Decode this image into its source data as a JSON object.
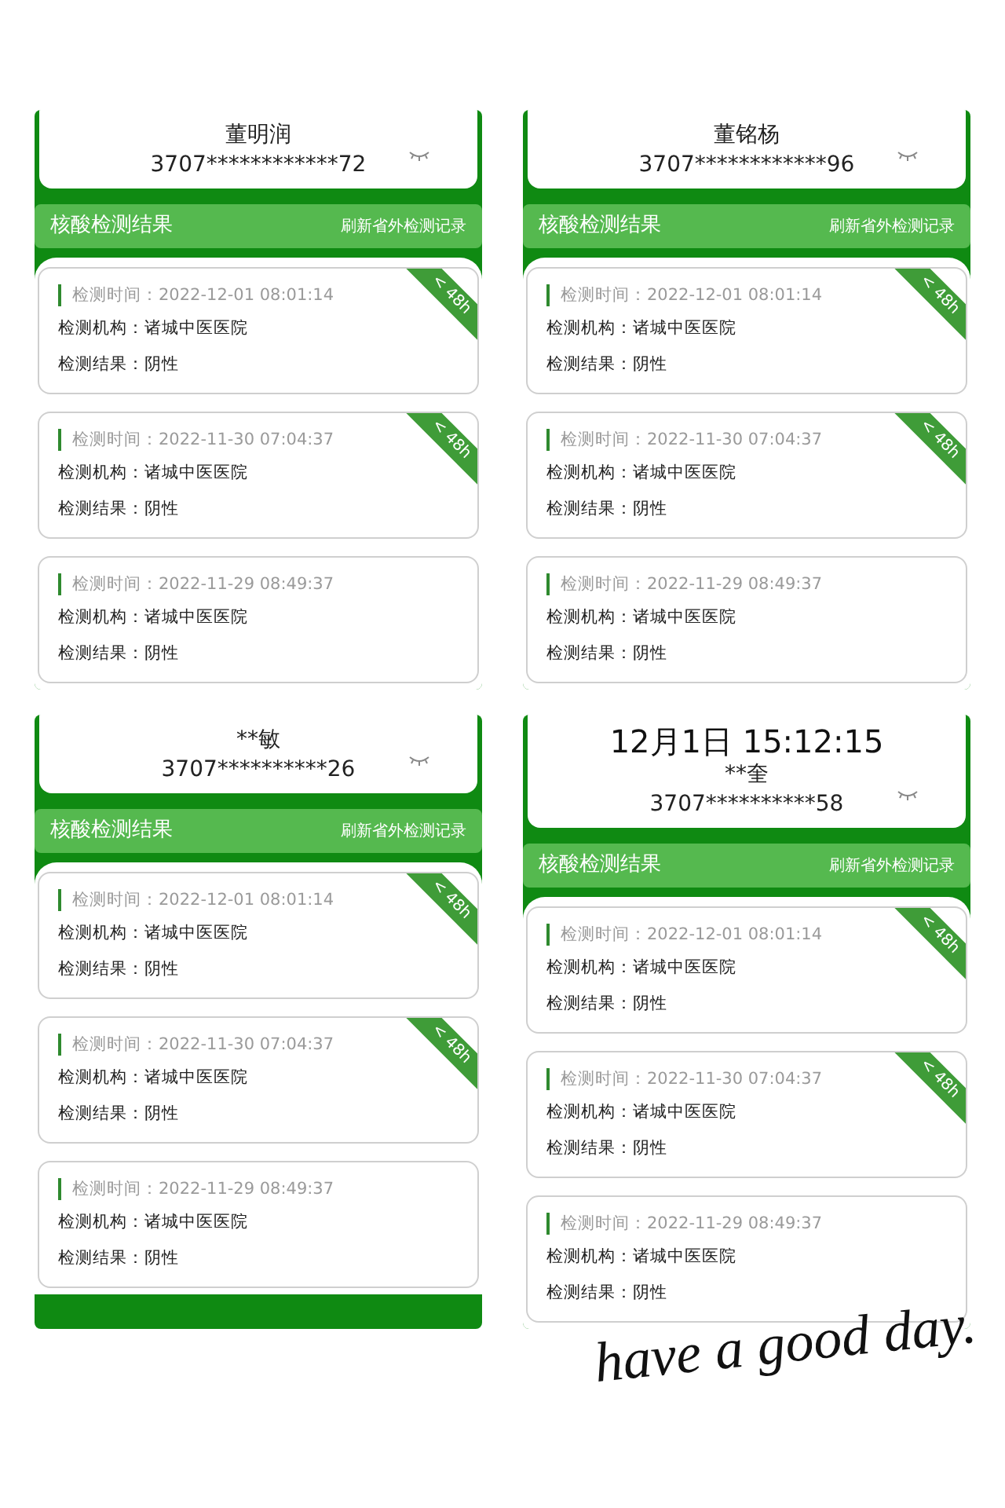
{
  "panels": [
    {
      "name": "董明润",
      "id_number": "3707************72",
      "section_title": "核酸检测结果",
      "refresh_link": "刷新省外检测记录",
      "records": [
        {
          "time": "检测时间：2022-12-01 08:01:14",
          "org": "检测机构：诸城中医医院",
          "result": "检测结果：阴性",
          "badge": "< 48h"
        },
        {
          "time": "检测时间：2022-11-30 07:04:37",
          "org": "检测机构：诸城中医医院",
          "result": "检测结果：阴性",
          "badge": "< 48h"
        },
        {
          "time": "检测时间：2022-11-29 08:49:37",
          "org": "检测机构：诸城中医医院",
          "result": "检测结果：阴性"
        }
      ]
    },
    {
      "name": "董铭杨",
      "id_number": "3707************96",
      "section_title": "核酸检测结果",
      "refresh_link": "刷新省外检测记录",
      "records": [
        {
          "time": "检测时间：2022-12-01 08:01:14",
          "org": "检测机构：诸城中医医院",
          "result": "检测结果：阴性",
          "badge": "< 48h"
        },
        {
          "time": "检测时间：2022-11-30 07:04:37",
          "org": "检测机构：诸城中医医院",
          "result": "检测结果：阴性",
          "badge": "< 48h"
        },
        {
          "time": "检测时间：2022-11-29 08:49:37",
          "org": "检测机构：诸城中医医院",
          "result": "检测结果：阴性"
        }
      ]
    },
    {
      "name": "**敏",
      "id_number": "3707**********26",
      "section_title": "核酸检测结果",
      "refresh_link": "刷新省外检测记录",
      "records": [
        {
          "time": "检测时间：2022-12-01 08:01:14",
          "org": "检测机构：诸城中医医院",
          "result": "检测结果：阴性",
          "badge": "< 48h"
        },
        {
          "time": "检测时间：2022-11-30 07:04:37",
          "org": "检测机构：诸城中医医院",
          "result": "检测结果：阴性",
          "badge": "< 48h"
        },
        {
          "time": "检测时间：2022-11-29 08:49:37",
          "org": "检测机构：诸城中医医院",
          "result": "检测结果：阴性"
        }
      ]
    },
    {
      "header_time": "12月1日 15:12:15",
      "name": "**奎",
      "id_number": "3707**********58",
      "section_title": "核酸检测结果",
      "refresh_link": "刷新省外检测记录",
      "records": [
        {
          "time": "检测时间：2022-12-01 08:01:14",
          "org": "检测机构：诸城中医医院",
          "result": "检测结果：阴性",
          "badge": "< 48h"
        },
        {
          "time": "检测时间：2022-11-30 07:04:37",
          "org": "检测机构：诸城中医医院",
          "result": "检测结果：阴性",
          "badge": "< 48h"
        },
        {
          "time": "检测时间：2022-11-29 08:49:37",
          "org": "检测机构：诸城中医医院",
          "result": "检测结果：阴性"
        }
      ]
    }
  ],
  "handwriting": "have a good day."
}
